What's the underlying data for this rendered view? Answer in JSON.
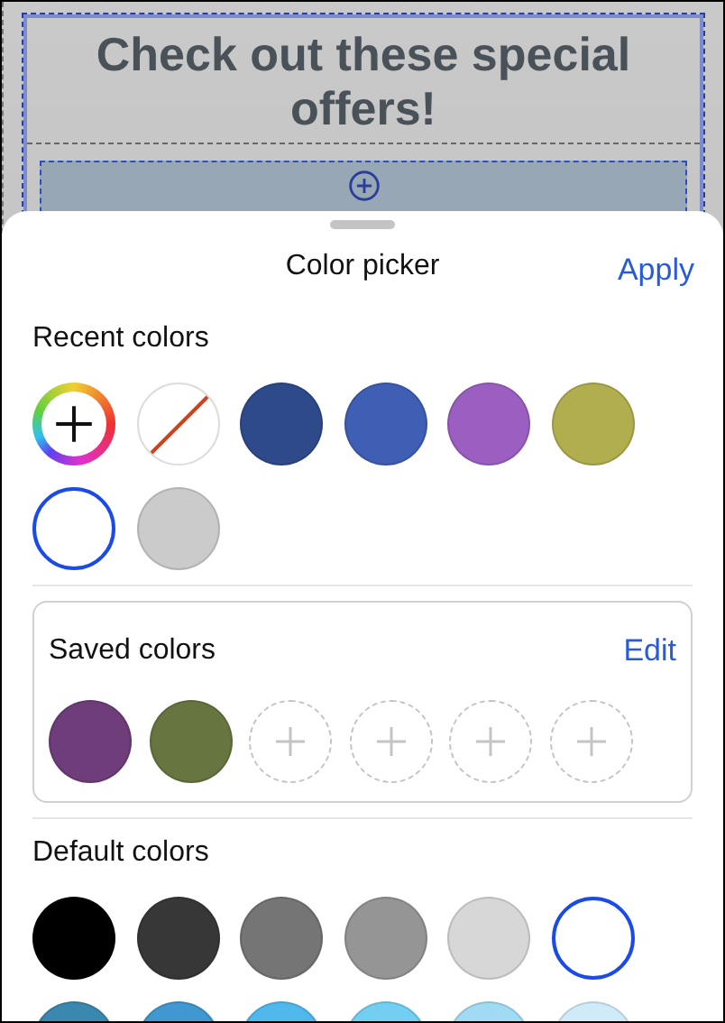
{
  "background": {
    "heading": "Check out these special offers!"
  },
  "sheet": {
    "title": "Color picker",
    "apply": "Apply"
  },
  "recent": {
    "title": "Recent colors",
    "swatches": [
      {
        "kind": "custom",
        "selected": false
      },
      {
        "kind": "none",
        "selected": false
      },
      {
        "kind": "color",
        "color": "#2f4a8b",
        "selected": false
      },
      {
        "kind": "color",
        "color": "#3f5fb5",
        "selected": false
      },
      {
        "kind": "color",
        "color": "#9b5fc2",
        "selected": false
      },
      {
        "kind": "color",
        "color": "#b1ae4f",
        "selected": false
      },
      {
        "kind": "color",
        "color": "#ffffff",
        "selected": true
      },
      {
        "kind": "color",
        "color": "#cbcbcb",
        "selected": false
      }
    ]
  },
  "saved": {
    "title": "Saved colors",
    "edit": "Edit",
    "swatches": [
      {
        "kind": "color",
        "color": "#6e3d7a",
        "selected": false
      },
      {
        "kind": "color",
        "color": "#677540",
        "selected": false
      },
      {
        "kind": "add"
      },
      {
        "kind": "add"
      },
      {
        "kind": "add"
      },
      {
        "kind": "add"
      }
    ]
  },
  "default": {
    "title": "Default colors",
    "swatches": [
      {
        "kind": "color",
        "color": "#000000",
        "selected": false
      },
      {
        "kind": "color",
        "color": "#373737",
        "selected": false
      },
      {
        "kind": "color",
        "color": "#757575",
        "selected": false
      },
      {
        "kind": "color",
        "color": "#959595",
        "selected": false
      },
      {
        "kind": "color",
        "color": "#d7d7d7",
        "selected": false
      },
      {
        "kind": "color",
        "color": "#ffffff",
        "selected": true
      },
      {
        "kind": "color",
        "color": "#3a88b0",
        "selected": false
      },
      {
        "kind": "color",
        "color": "#3f98d0",
        "selected": false
      },
      {
        "kind": "color",
        "color": "#4fb8ec",
        "selected": false
      },
      {
        "kind": "color",
        "color": "#72cff2",
        "selected": false
      },
      {
        "kind": "color",
        "color": "#a0dbf3",
        "selected": false
      },
      {
        "kind": "color",
        "color": "#d0ebf8",
        "selected": false
      }
    ]
  }
}
